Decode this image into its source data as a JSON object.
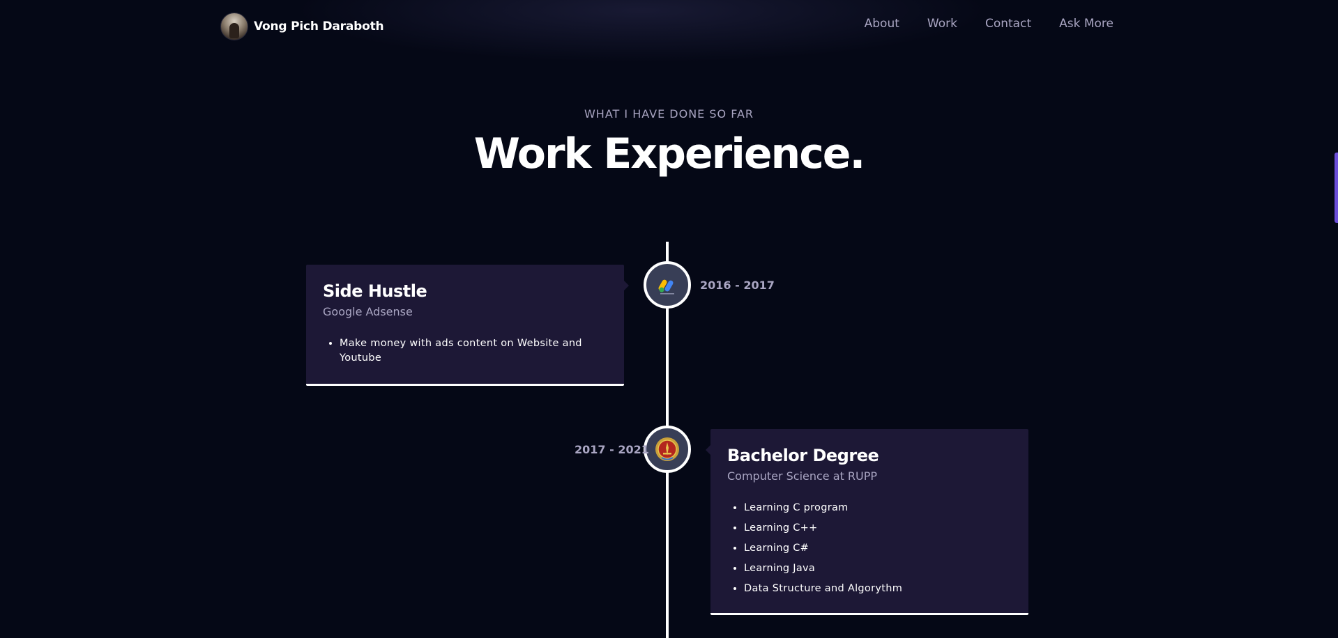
{
  "brand": {
    "name": "Vong Pich Daraboth"
  },
  "nav": {
    "links": [
      "About",
      "Work",
      "Contact",
      "Ask More"
    ]
  },
  "section": {
    "subtitle": "WHAT I HAVE DONE SO FAR",
    "title": "Work Experience."
  },
  "experiences": [
    {
      "title": "Side Hustle",
      "company": "Google Adsense",
      "date": "2016 - 2017",
      "icon": "google-adsense-icon",
      "points": [
        "Make money with ads content on Website and Youtube"
      ]
    },
    {
      "title": "Bachelor Degree",
      "company": "Computer Science at RUPP",
      "date": "2017 - 2021",
      "icon": "rupp-emblem-icon",
      "points": [
        "Learning C program",
        "Learning C++",
        "Learning C#",
        "Learning Java",
        "Data Structure and Algorythm"
      ]
    }
  ],
  "colors": {
    "background": "#050816",
    "card": "#1d1836",
    "secondary_text": "#aaa6c3",
    "timeline": "#ffffff",
    "icon_bg": "#383e56",
    "scroll_accent": "#6c4fd8"
  }
}
